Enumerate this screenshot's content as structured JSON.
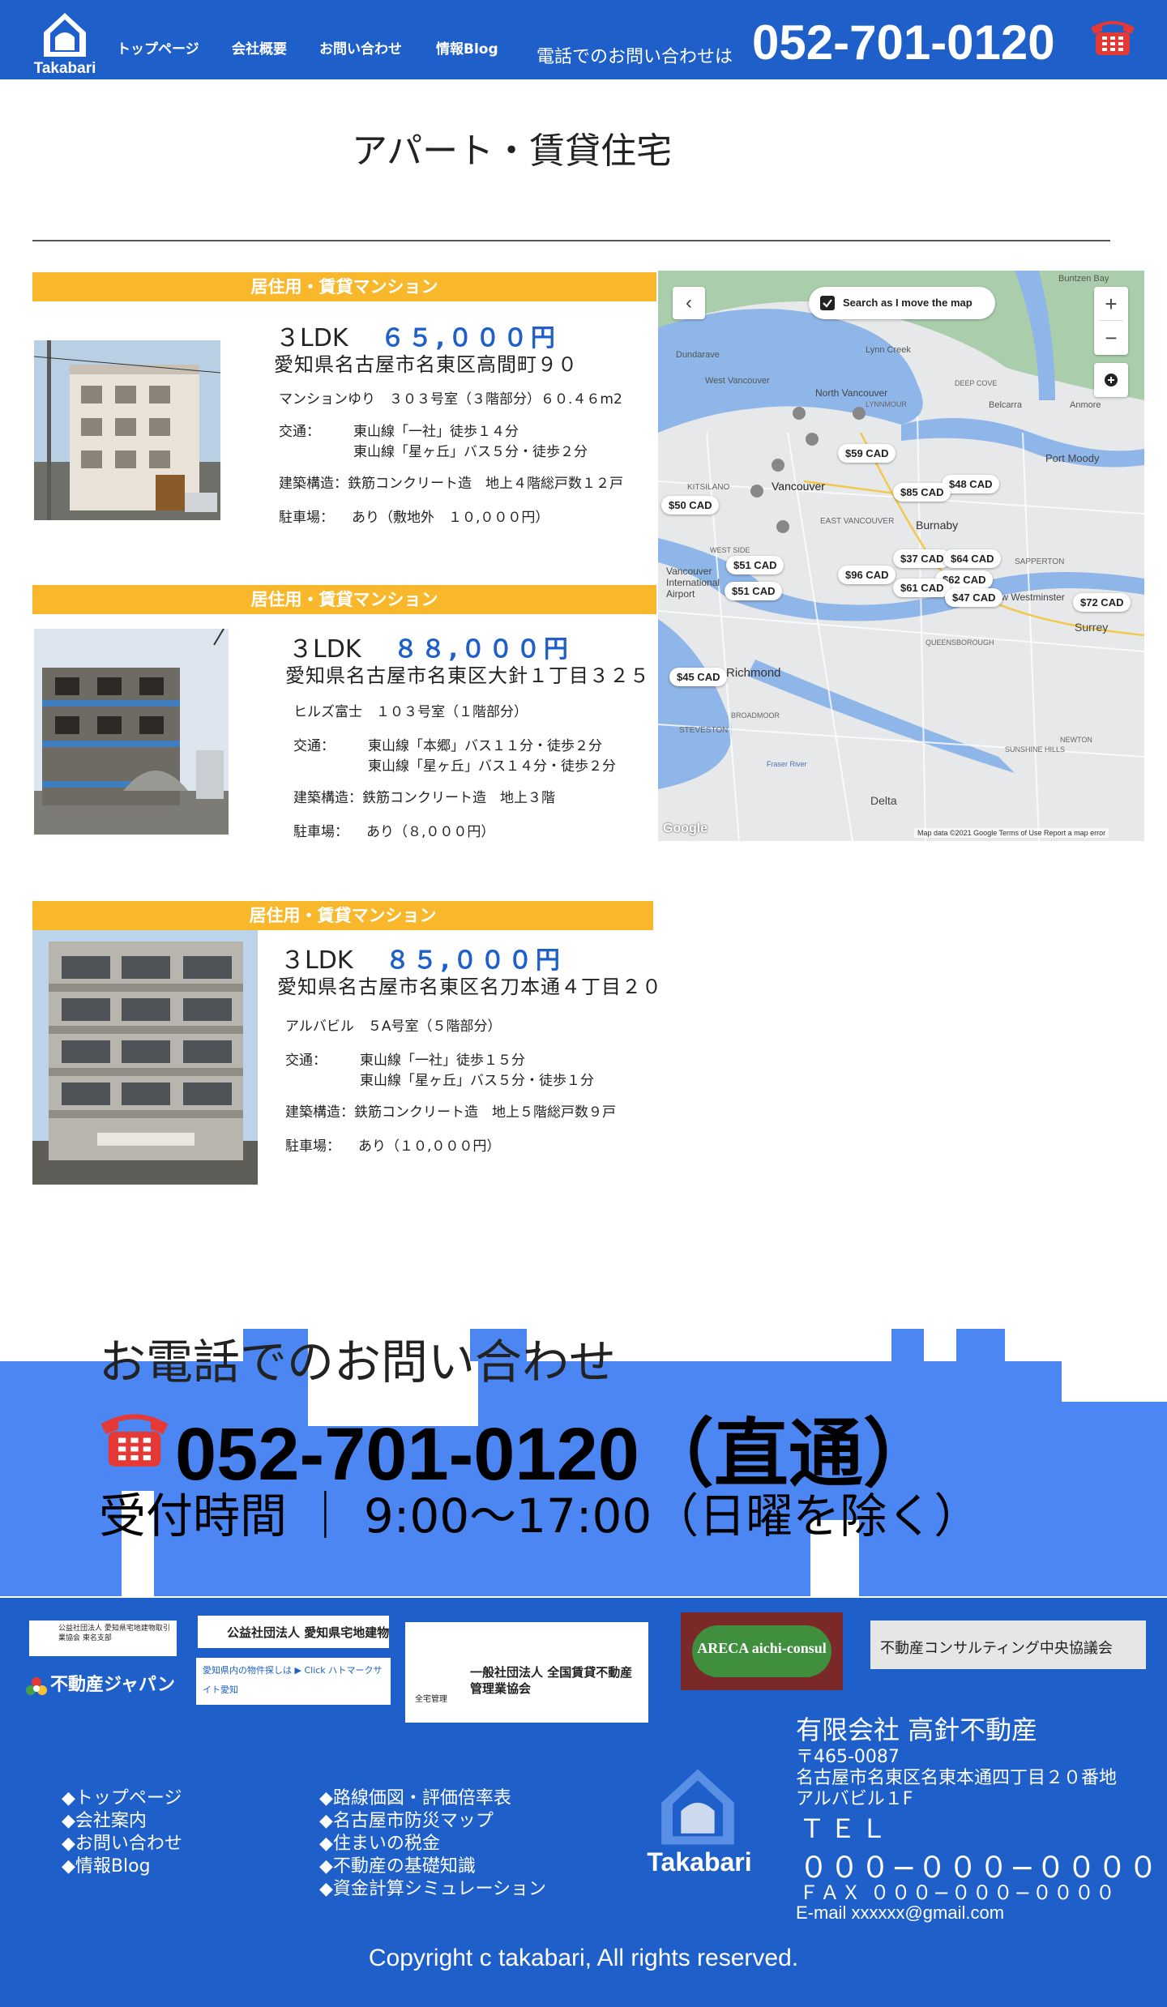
{
  "header": {
    "logo_text": "Takabari",
    "nav": [
      "トップページ",
      "会社概要",
      "お問い合わせ",
      "情報Blog"
    ],
    "phone_label": "電話でのお問い合わせは",
    "phone": "052-701-0120"
  },
  "page_title": "アパート・賃貸住宅",
  "listings": [
    {
      "category": "居住用・賃貸マンション",
      "layout": "３LDK",
      "price": "６５,０００円",
      "address": "愛知県名古屋市名東区高間町９０",
      "building": "マンションゆり　３０３号室（３階部分）６０.４６m2",
      "access_label": "交通：",
      "access": [
        "東山線「一社」徒歩１４分",
        "東山線「星ヶ丘」バス５分・徒歩２分"
      ],
      "structure_label": "建築構造：",
      "structure": "鉄筋コンクリート造　地上４階総戸数１２戸",
      "parking_label": "駐車場：",
      "parking": "あり（敷地外　１０,０００円）"
    },
    {
      "category": "居住用・賃貸マンション",
      "layout": "３LDK",
      "price": "８８,０００円",
      "address": "愛知県名古屋市名東区大針１丁目３２５",
      "building": "ヒルズ富士　１０３号室（１階部分）",
      "access_label": "交通：",
      "access": [
        "東山線「本郷」バス１１分・徒歩２分",
        "東山線「星ヶ丘」バス１４分・徒歩２分"
      ],
      "structure_label": "建築構造：",
      "structure": "鉄筋コンクリート造　地上３階",
      "parking_label": "駐車場：",
      "parking": "あり（８,０００円）"
    },
    {
      "category": "居住用・賃貸マンション",
      "layout": "３LDK",
      "price": "８５,０００円",
      "address": "愛知県名古屋市名東区名刀本通４丁目２０",
      "building": "アルバビル　５A号室（５階部分）",
      "access_label": "交通：",
      "access": [
        "東山線「一社」徒歩１５分",
        "東山線「星ヶ丘」バス５分・徒歩１分"
      ],
      "structure_label": "建築構造：",
      "structure": "鉄筋コンクリート造　地上５階総戸数９戸",
      "parking_label": "駐車場：",
      "parking": "あり（１０,０００円）"
    }
  ],
  "map": {
    "search_label": "Search as I move the map",
    "zoom_in": "+",
    "zoom_out": "−",
    "back": "‹",
    "google": "Google",
    "attribution": "Map data ©2021 Google   Terms of Use   Report a map error",
    "prices": [
      "$59 CAD",
      "$48 CAD",
      "$85 CAD",
      "$50 CAD",
      "$37 CAD",
      "$64 CAD",
      "$51 CAD",
      "$96 CAD",
      "$62 CAD",
      "$61 CAD",
      "$47 CAD",
      "$51 CAD",
      "$72 CAD",
      "$45 CAD"
    ],
    "places": [
      "Dundarave",
      "Lynn Creek",
      "North Vancouver",
      "Vancouver",
      "West Vancouver",
      "Burnaby",
      "Port Moody",
      "Richmond",
      "Surrey",
      "New Westminster",
      "Delta",
      "Belcarra",
      "Anmore",
      "Buntzen Bay",
      "Vancouver International Airport",
      "KITSILANO",
      "DEEP COVE",
      "LYNNMOUR",
      "EAST VANCOUVER",
      "SAPPERTON",
      "STEVESTON",
      "BROADMOOR",
      "QUEENSBOROUGH",
      "SUNSHINE HILLS",
      "NEWTON",
      "WEST SIDE",
      "Fraser River"
    ]
  },
  "call": {
    "heading": "お電話でのお問い合わせ",
    "phone": "052-701-0120（直通）",
    "hours": "受付時間 ｜ 9:00～17:00（日曜を除く）"
  },
  "footer": {
    "badges": [
      "公益社団法人 愛知県宅地建物取引業協会 東名支部",
      "公益社団法人 愛知県宅地建物取引業協会",
      "一般社団法人 全国賃貸不動産管理業協会",
      "ARECA aichi-consul",
      "不動産コンサルティング中央協議会",
      "不動産ジャパン",
      "愛知県内の物件探しは ▶ Click ハトマークサイト愛知",
      "全宅管理"
    ],
    "links_left": [
      "◆トップページ",
      "◆会社案内",
      "◆お問い合わせ",
      "◆情報Blog"
    ],
    "links_right": [
      "◆路線価図・評価倍率表",
      "◆名古屋市防災マップ",
      "◆住まいの税金",
      "◆不動産の基礎知識",
      "◆資金計算シミュレーション"
    ],
    "logo_text": "Takabari",
    "company": "有限会社 高針不動産",
    "postal": "〒465-0087",
    "address1": "名古屋市名東区名東本通四丁目２０番地",
    "address2": "アルバビル１F",
    "tel_label": "ＴＥＬ",
    "tel": "０００−０００−００００",
    "fax": "ＦＡＸ ０００−０００−００００",
    "email": "E-mail xxxxxx@gmail.com",
    "copyright": "Copyright c takabari, All rights reserved."
  },
  "colors": {
    "brand_blue": "#1e5fc9",
    "ribbon_yellow": "#f9b72c",
    "band_blue": "#4b86f2"
  }
}
